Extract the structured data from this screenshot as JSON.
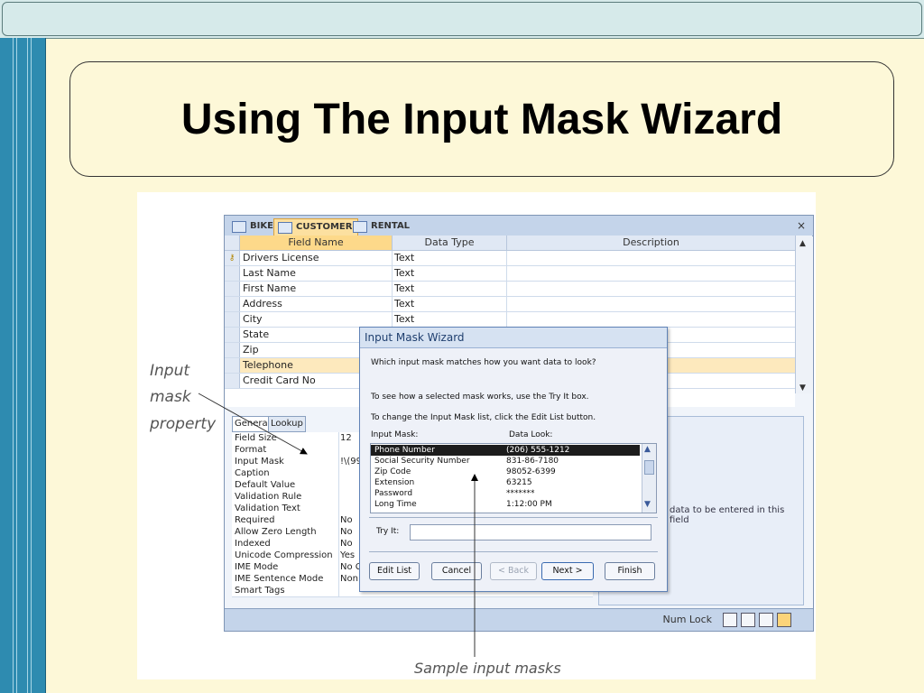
{
  "slide": {
    "title": "Using The Input Mask Wizard",
    "callout_input_mask": [
      "Input",
      "mask",
      "property"
    ],
    "callout_sample": "Sample input masks"
  },
  "access": {
    "tabs": [
      "BIKE",
      "CUSTOMER",
      "RENTAL"
    ],
    "active_tab": "CUSTOMER",
    "close_label": "×",
    "columns": [
      "Field Name",
      "Data Type",
      "Description"
    ],
    "fields": [
      {
        "name": "Drivers License",
        "type": "Text"
      },
      {
        "name": "Last Name",
        "type": "Text"
      },
      {
        "name": "First Name",
        "type": "Text"
      },
      {
        "name": "Address",
        "type": "Text"
      },
      {
        "name": "City",
        "type": "Text"
      },
      {
        "name": "State",
        "type": ""
      },
      {
        "name": "Zip",
        "type": ""
      },
      {
        "name": "Telephone",
        "type": ""
      },
      {
        "name": "Credit Card No",
        "type": ""
      }
    ],
    "prop_tabs": [
      "General",
      "Lookup"
    ],
    "properties": [
      {
        "label": "Field Size",
        "value": "12"
      },
      {
        "label": "Format",
        "value": ""
      },
      {
        "label": "Input Mask",
        "value": "!\\(99"
      },
      {
        "label": "Caption",
        "value": ""
      },
      {
        "label": "Default Value",
        "value": ""
      },
      {
        "label": "Validation Rule",
        "value": ""
      },
      {
        "label": "Validation Text",
        "value": ""
      },
      {
        "label": "Required",
        "value": "No"
      },
      {
        "label": "Allow Zero Length",
        "value": "No"
      },
      {
        "label": "Indexed",
        "value": "No"
      },
      {
        "label": "Unicode Compression",
        "value": "Yes"
      },
      {
        "label": "IME Mode",
        "value": "No C"
      },
      {
        "label": "IME Sentence Mode",
        "value": "Non"
      },
      {
        "label": "Smart Tags",
        "value": ""
      }
    ],
    "help_text": "data to be entered in this field",
    "status_numlock": "Num Lock"
  },
  "wizard": {
    "title": "Input Mask Wizard",
    "question": "Which input mask matches how you want data to look?",
    "hint1": "To see how a selected mask works, use the Try It box.",
    "hint2": "To change the Input Mask list, click the Edit List button.",
    "col_mask": "Input Mask:",
    "col_look": "Data Look:",
    "masks": [
      {
        "name": "Phone Number",
        "look": "(206) 555-1212"
      },
      {
        "name": "Social Security Number",
        "look": "831-86-7180"
      },
      {
        "name": "Zip Code",
        "look": "98052-6399"
      },
      {
        "name": "Extension",
        "look": "63215"
      },
      {
        "name": "Password",
        "look": "*******"
      },
      {
        "name": "Long Time",
        "look": "1:12:00 PM"
      }
    ],
    "selected_mask": "Phone Number",
    "try_it_label": "Try It:",
    "try_it_value": "",
    "buttons": {
      "edit_list": "Edit List",
      "cancel": "Cancel",
      "back": "< Back",
      "next": "Next >",
      "finish": "Finish"
    }
  }
}
